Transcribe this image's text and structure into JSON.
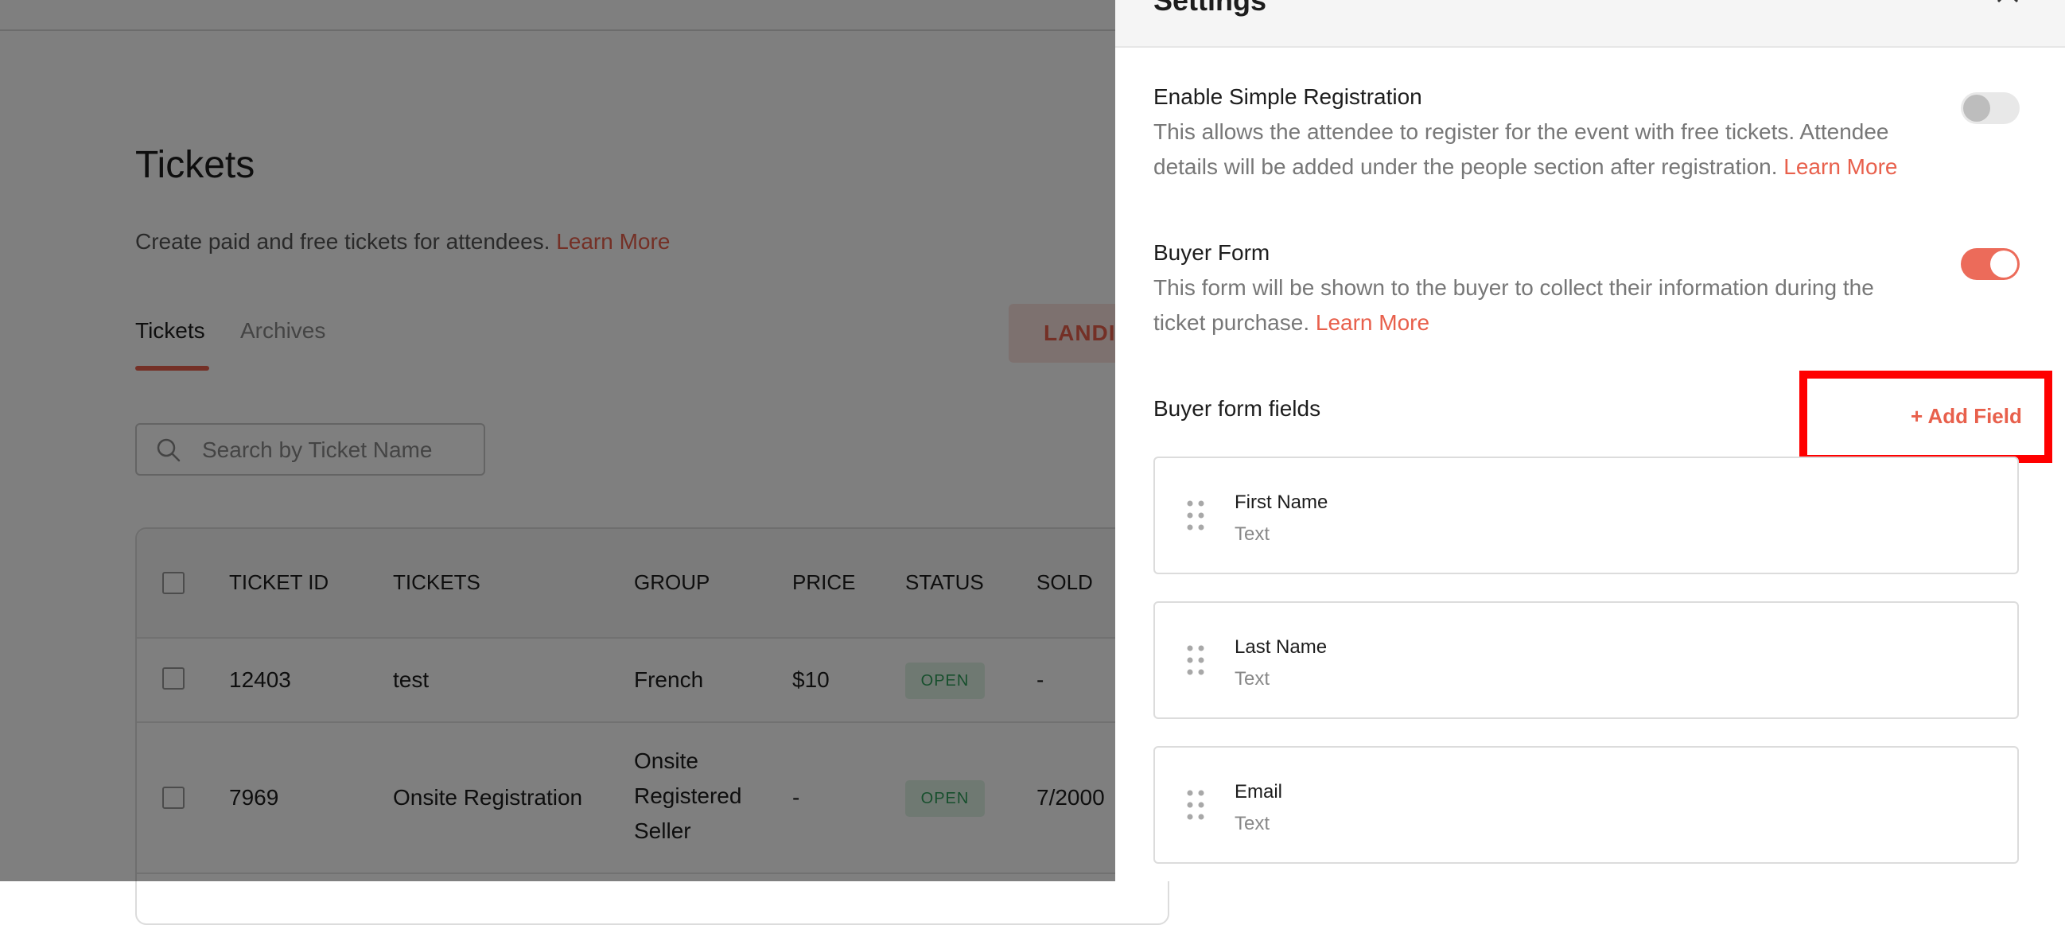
{
  "page": {
    "title": "Tickets",
    "description": "Create paid and free tickets for attendees.",
    "learn_more": "Learn More",
    "tabs": [
      {
        "label": "Tickets",
        "active": true
      },
      {
        "label": "Archives",
        "active": false
      }
    ],
    "landing_button": "LANDI",
    "search": {
      "placeholder": "Search by Ticket Name",
      "value": ""
    },
    "table": {
      "headers": [
        "TICKET ID",
        "TICKETS",
        "GROUP",
        "PRICE",
        "STATUS",
        "SOLD"
      ],
      "rows": [
        {
          "id": "12403",
          "ticket": "test",
          "group": [
            "French"
          ],
          "price": "$10",
          "status": "OPEN",
          "sold": "-"
        },
        {
          "id": "7969",
          "ticket": "Onsite Registration",
          "group": [
            "Onsite",
            "Registered",
            "Seller"
          ],
          "price": "-",
          "status": "OPEN",
          "sold": "7/2000"
        }
      ]
    }
  },
  "drawer": {
    "title": "Settings",
    "simple_registration": {
      "title": "Enable Simple Registration",
      "desc_line1": "This allows the attendee to register for the event with free tickets. Attendee",
      "desc_line2": "details will be added under the people section after registration.",
      "learn_more": "Learn More",
      "enabled": false
    },
    "buyer_form": {
      "title": "Buyer Form",
      "desc_line1": "This form will be shown to the buyer to collect their information during the",
      "desc_line2": "ticket purchase.",
      "learn_more": "Learn More",
      "enabled": true
    },
    "fields_title": "Buyer form fields",
    "add_field_label": "+ Add Field",
    "fields": [
      {
        "name": "First Name",
        "type": "Text"
      },
      {
        "name": "Last Name",
        "type": "Text"
      },
      {
        "name": "Email",
        "type": "Text"
      }
    ]
  },
  "colors": {
    "accent": "#e8604c",
    "toggle_on": "#ec6b5a",
    "status_open_bg": "#dff3e4",
    "status_open_text": "#2f9e5a",
    "highlight": "#ff0000"
  }
}
